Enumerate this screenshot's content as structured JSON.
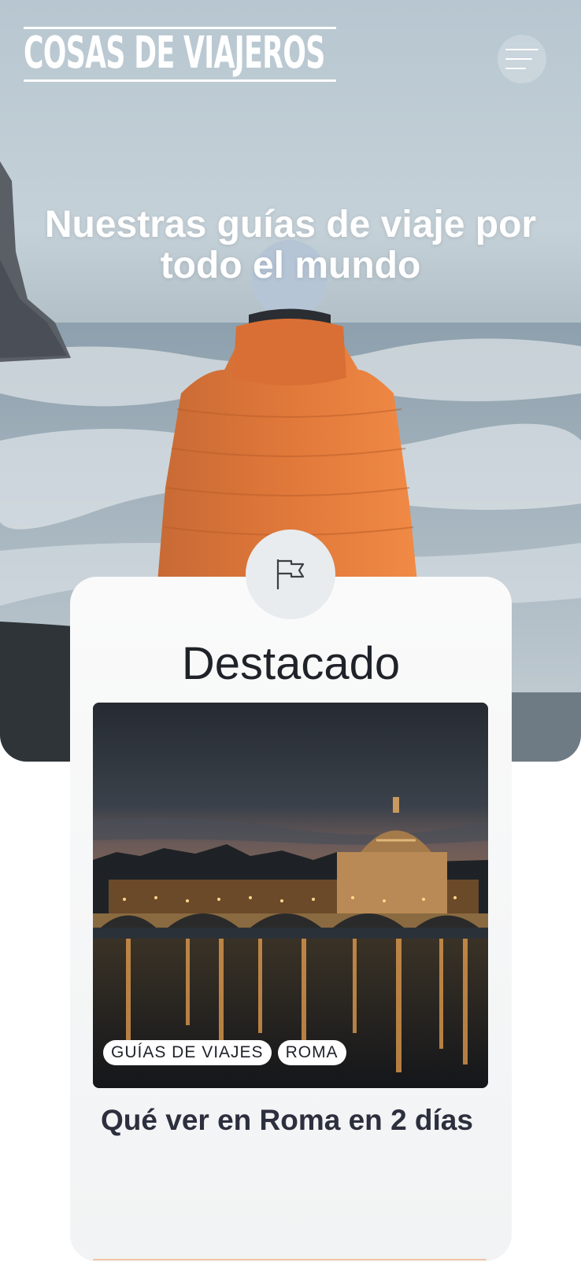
{
  "header": {
    "logo_text": "COSAS DE VIAJEROS",
    "menu_icon": "hamburger-menu-icon"
  },
  "hero": {
    "title": "Nuestras guías de viaje por todo el mundo"
  },
  "featured": {
    "icon": "flag-icon",
    "heading": "Destacado",
    "post": {
      "tags": [
        "GUÍAS DE VIAJES",
        "ROMA"
      ],
      "title": "Qué ver en Roma en 2 días"
    }
  },
  "colors": {
    "jacket_orange": "#e0783a",
    "title_dark": "#2c2f3d",
    "card_bg": "#f4f5f6"
  }
}
